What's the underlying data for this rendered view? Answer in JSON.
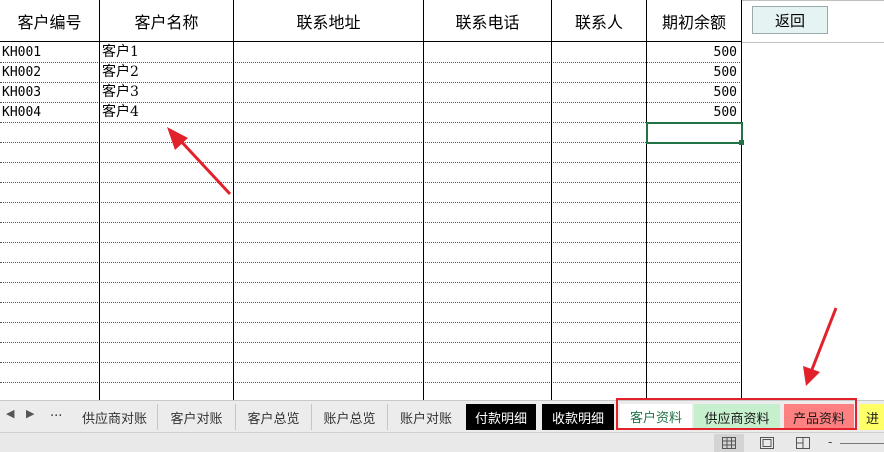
{
  "sheet": {
    "headers": [
      "客户编号",
      "客户名称",
      "联系地址",
      "联系电话",
      "联系人",
      "期初余额"
    ],
    "rows": [
      {
        "code": "KH001",
        "name": "客户1",
        "balance": "500"
      },
      {
        "code": "KH002",
        "name": "客户2",
        "balance": "500"
      },
      {
        "code": "KH003",
        "name": "客户3",
        "balance": "500"
      },
      {
        "code": "KH004",
        "name": "客户4",
        "balance": "500"
      }
    ],
    "return_label": "返回"
  },
  "tabs": {
    "nav_prev": "◀",
    "nav_next": "▶",
    "nav_more": "...",
    "items": [
      {
        "label": "供应商对账",
        "style": "plain"
      },
      {
        "label": "客户对账",
        "style": "plain"
      },
      {
        "label": "客户总览",
        "style": "plain"
      },
      {
        "label": "账户总览",
        "style": "plain"
      },
      {
        "label": "账户对账",
        "style": "plain"
      },
      {
        "label": "付款明细",
        "style": "dark"
      },
      {
        "label": "收款明细",
        "style": "dark"
      },
      {
        "label": "客户资料",
        "style": "active"
      },
      {
        "label": "供应商资料",
        "style": "green"
      },
      {
        "label": "产品资料",
        "style": "red"
      },
      {
        "label": "进",
        "style": "yellow"
      }
    ]
  },
  "colors": {
    "accent_green": "#217346",
    "annotation_red": "#e2222a"
  },
  "icons": {
    "view_normal": "grid-view-icon",
    "view_page_layout": "page-layout-icon",
    "view_page_break": "page-break-icon"
  }
}
